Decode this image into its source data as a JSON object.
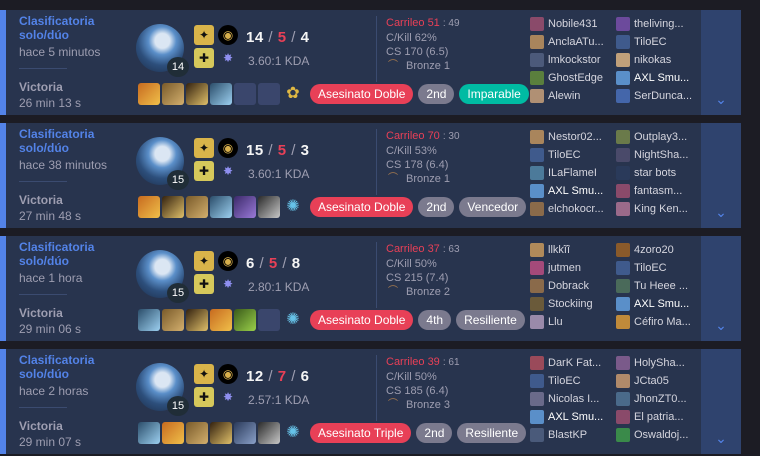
{
  "colors": {
    "win_blue": "#5383e8",
    "kill_red": "#e84057",
    "green": "#00bba3",
    "bg": "#28344e"
  },
  "matches": [
    {
      "queue": "Clasificatoria solo/dúo",
      "ago": "hace 5 minutos",
      "result": "Victoria",
      "duration": "26 min 13 s",
      "champion_icon": "jinx-portrait-icon",
      "level": "14",
      "kills": "14",
      "deaths": "5",
      "assists": "4",
      "ratio": "3.60:1 KDA",
      "kill_participation_label": "Carrileo 51",
      "kill_participation_extra": ": 49",
      "ckill": "C/Kill 62%",
      "cs": "CS 170 (6.5)",
      "rank": "Bronze 1",
      "badges": [
        {
          "label": "Asesinato Doble",
          "style": "red"
        },
        {
          "label": "2nd",
          "style": "grey"
        },
        {
          "label": "Imparable",
          "style": "green"
        }
      ],
      "team1": [
        "Nobile431",
        "AnclaATu...",
        "lmkockstor",
        "GhostEdge",
        "Alewin"
      ],
      "team2": [
        "theliving...",
        "TiloEC",
        "nikokas",
        "AXL Smu...",
        "SerDunca..."
      ]
    },
    {
      "queue": "Clasificatoria solo/dúo",
      "ago": "hace 38 minutos",
      "result": "Victoria",
      "duration": "27 min 48 s",
      "champion_icon": "jinx-portrait-icon",
      "level": "15",
      "kills": "15",
      "deaths": "5",
      "assists": "3",
      "ratio": "3.60:1 KDA",
      "kill_participation_label": "Carrileo 70",
      "kill_participation_extra": ": 30",
      "ckill": "C/Kill 53%",
      "cs": "CS 178 (6.4)",
      "rank": "Bronze 1",
      "badges": [
        {
          "label": "Asesinato Doble",
          "style": "red"
        },
        {
          "label": "2nd",
          "style": "grey"
        },
        {
          "label": "Vencedor",
          "style": "grey"
        }
      ],
      "team1": [
        "Nestor02...",
        "TiloEC",
        "ILaFlameI",
        "AXL Smu...",
        "elchokocr..."
      ],
      "team2": [
        "Outplay3...",
        "NightSha...",
        "star bots",
        "fantasm...",
        "King Ken..."
      ]
    },
    {
      "queue": "Clasificatoria solo/dúo",
      "ago": "hace 1 hora",
      "result": "Victoria",
      "duration": "29 min 06 s",
      "champion_icon": "jinx-portrait-icon",
      "level": "15",
      "kills": "6",
      "deaths": "5",
      "assists": "8",
      "ratio": "2.80:1 KDA",
      "kill_participation_label": "Carrileo 37",
      "kill_participation_extra": ": 63",
      "ckill": "C/Kill 50%",
      "cs": "CS 215 (7.4)",
      "rank": "Bronze 2",
      "badges": [
        {
          "label": "Asesinato Doble",
          "style": "red"
        },
        {
          "label": "4th",
          "style": "grey"
        },
        {
          "label": "Resiliente",
          "style": "grey"
        }
      ],
      "team1": [
        "llkkĩĩ",
        "jutmen",
        "Dobrack",
        "Stockiing",
        "Llu"
      ],
      "team2": [
        "4zoro20",
        "TiloEC",
        "Tu Heee ...",
        "AXL Smu...",
        "Céfiro Ma..."
      ]
    },
    {
      "queue": "Clasificatoria solo/dúo",
      "ago": "hace 2 horas",
      "result": "Victoria",
      "duration": "29 min 07 s",
      "champion_icon": "jinx-portrait-icon",
      "level": "15",
      "kills": "12",
      "deaths": "7",
      "assists": "6",
      "ratio": "2.57:1 KDA",
      "kill_participation_label": "Carrileo 39",
      "kill_participation_extra": ": 61",
      "ckill": "C/Kill 50%",
      "cs": "CS 185 (6.4)",
      "rank": "Bronze 3",
      "badges": [
        {
          "label": "Asesinato Triple",
          "style": "red"
        },
        {
          "label": "2nd",
          "style": "grey"
        },
        {
          "label": "Resiliente",
          "style": "grey"
        }
      ],
      "team1": [
        "DarK Fat...",
        "TiloEC",
        "Nicolas I...",
        "AXL Smu...",
        "BlastKP"
      ],
      "team2": [
        "HolySha...",
        "JCta05",
        "JhonZT0...",
        "El patria...",
        "Oswaldoj..."
      ]
    }
  ],
  "me": "AXL Smu..."
}
